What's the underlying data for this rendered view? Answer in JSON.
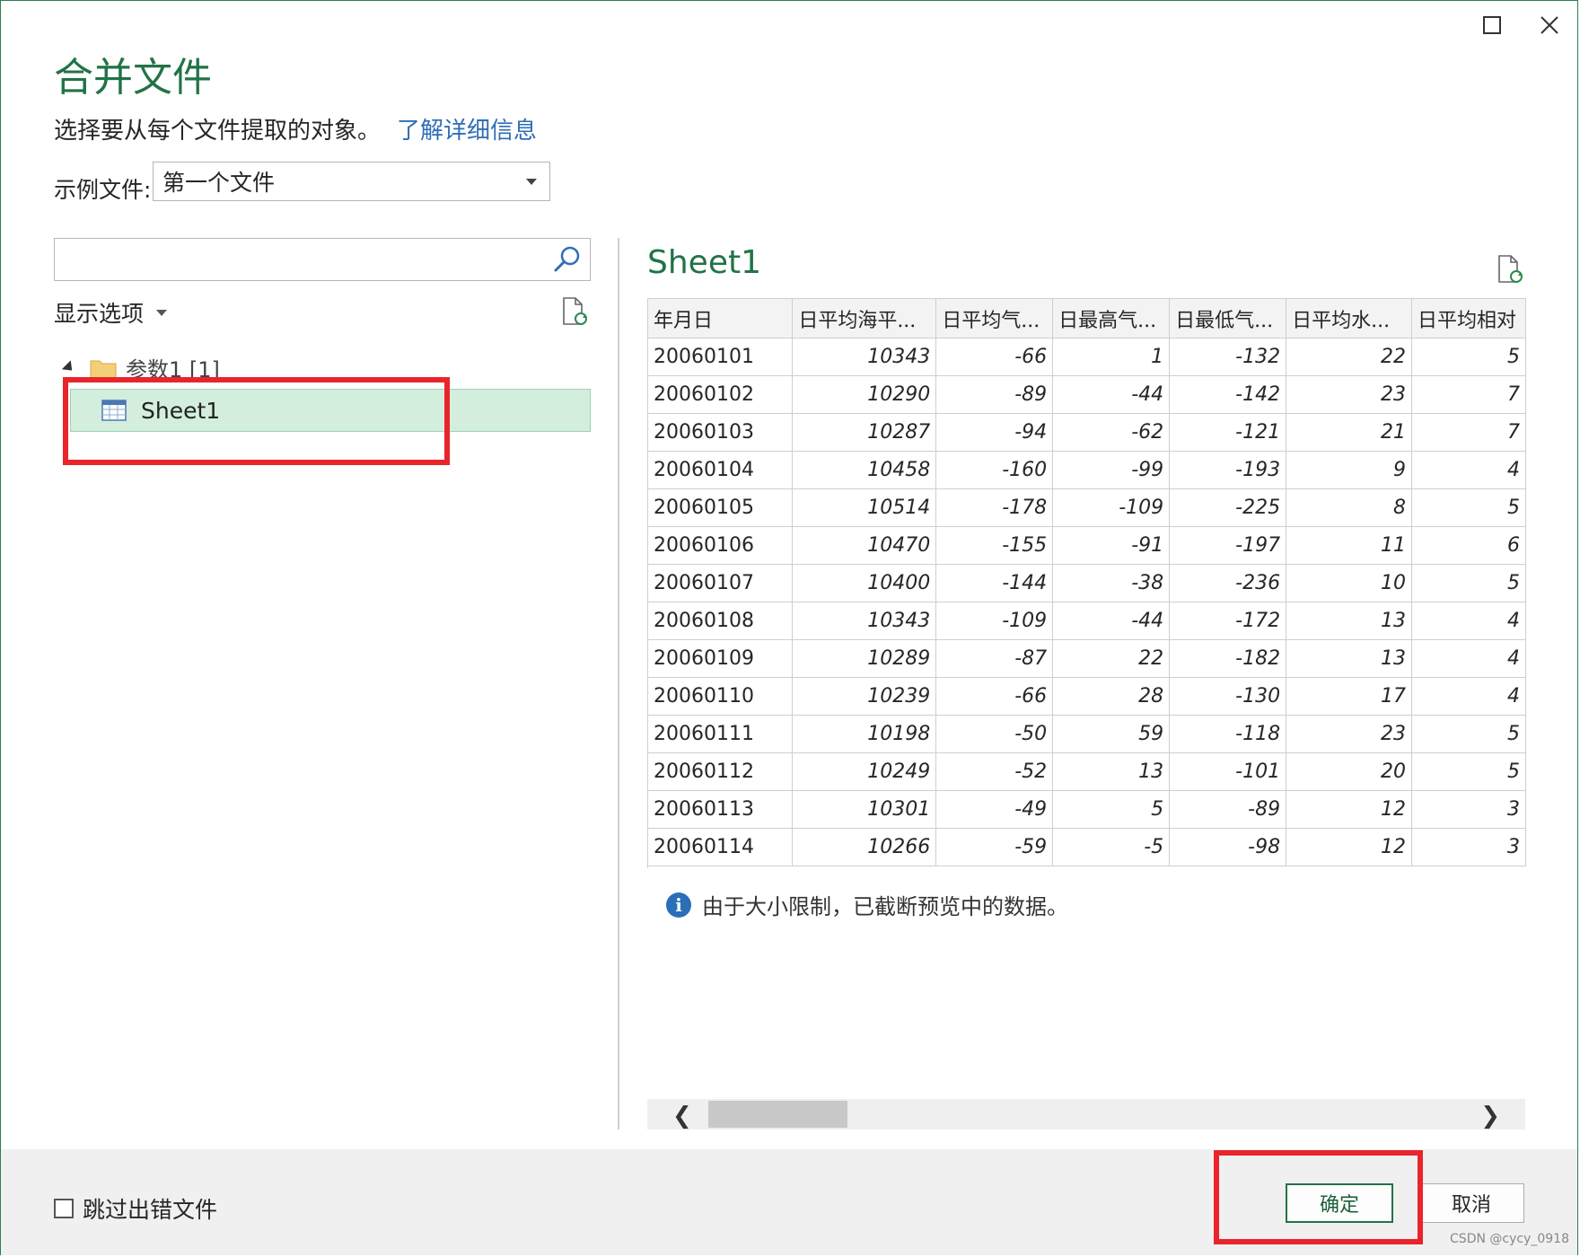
{
  "dialog": {
    "title": "合并文件",
    "subtitle": "选择要从每个文件提取的对象。",
    "learn_more": "了解详细信息",
    "sample_label": "示例文件:",
    "sample_value": "第一个文件",
    "search_placeholder": "",
    "display_options": "显示选项",
    "tree": {
      "folder": "参数1 [1]",
      "item": "Sheet1"
    }
  },
  "preview": {
    "title": "Sheet1",
    "columns": [
      "年月日",
      "日平均海平...",
      "日平均气...",
      "日最高气...",
      "日最低气...",
      "日平均水...",
      "日平均相对"
    ],
    "rows": [
      [
        "20060101",
        "10343",
        "-66",
        "1",
        "-132",
        "22",
        "5"
      ],
      [
        "20060102",
        "10290",
        "-89",
        "-44",
        "-142",
        "23",
        "7"
      ],
      [
        "20060103",
        "10287",
        "-94",
        "-62",
        "-121",
        "21",
        "7"
      ],
      [
        "20060104",
        "10458",
        "-160",
        "-99",
        "-193",
        "9",
        "4"
      ],
      [
        "20060105",
        "10514",
        "-178",
        "-109",
        "-225",
        "8",
        "5"
      ],
      [
        "20060106",
        "10470",
        "-155",
        "-91",
        "-197",
        "11",
        "6"
      ],
      [
        "20060107",
        "10400",
        "-144",
        "-38",
        "-236",
        "10",
        "5"
      ],
      [
        "20060108",
        "10343",
        "-109",
        "-44",
        "-172",
        "13",
        "4"
      ],
      [
        "20060109",
        "10289",
        "-87",
        "22",
        "-182",
        "13",
        "4"
      ],
      [
        "20060110",
        "10239",
        "-66",
        "28",
        "-130",
        "17",
        "4"
      ],
      [
        "20060111",
        "10198",
        "-50",
        "59",
        "-118",
        "23",
        "5"
      ],
      [
        "20060112",
        "10249",
        "-52",
        "13",
        "-101",
        "20",
        "5"
      ],
      [
        "20060113",
        "10301",
        "-49",
        "5",
        "-89",
        "12",
        "3"
      ],
      [
        "20060114",
        "10266",
        "-59",
        "-5",
        "-98",
        "12",
        "3"
      ]
    ],
    "truncation_note": "由于大小限制，已截断预览中的数据。"
  },
  "footer": {
    "skip_errors": "跳过出错文件",
    "ok": "确定",
    "cancel": "取消"
  },
  "watermark": "CSDN @cycy_0918",
  "colors": {
    "accent_green": "#217346",
    "link_blue": "#2f6db5",
    "selection_green": "#d3eedd",
    "annotation_red": "#e8252b"
  }
}
